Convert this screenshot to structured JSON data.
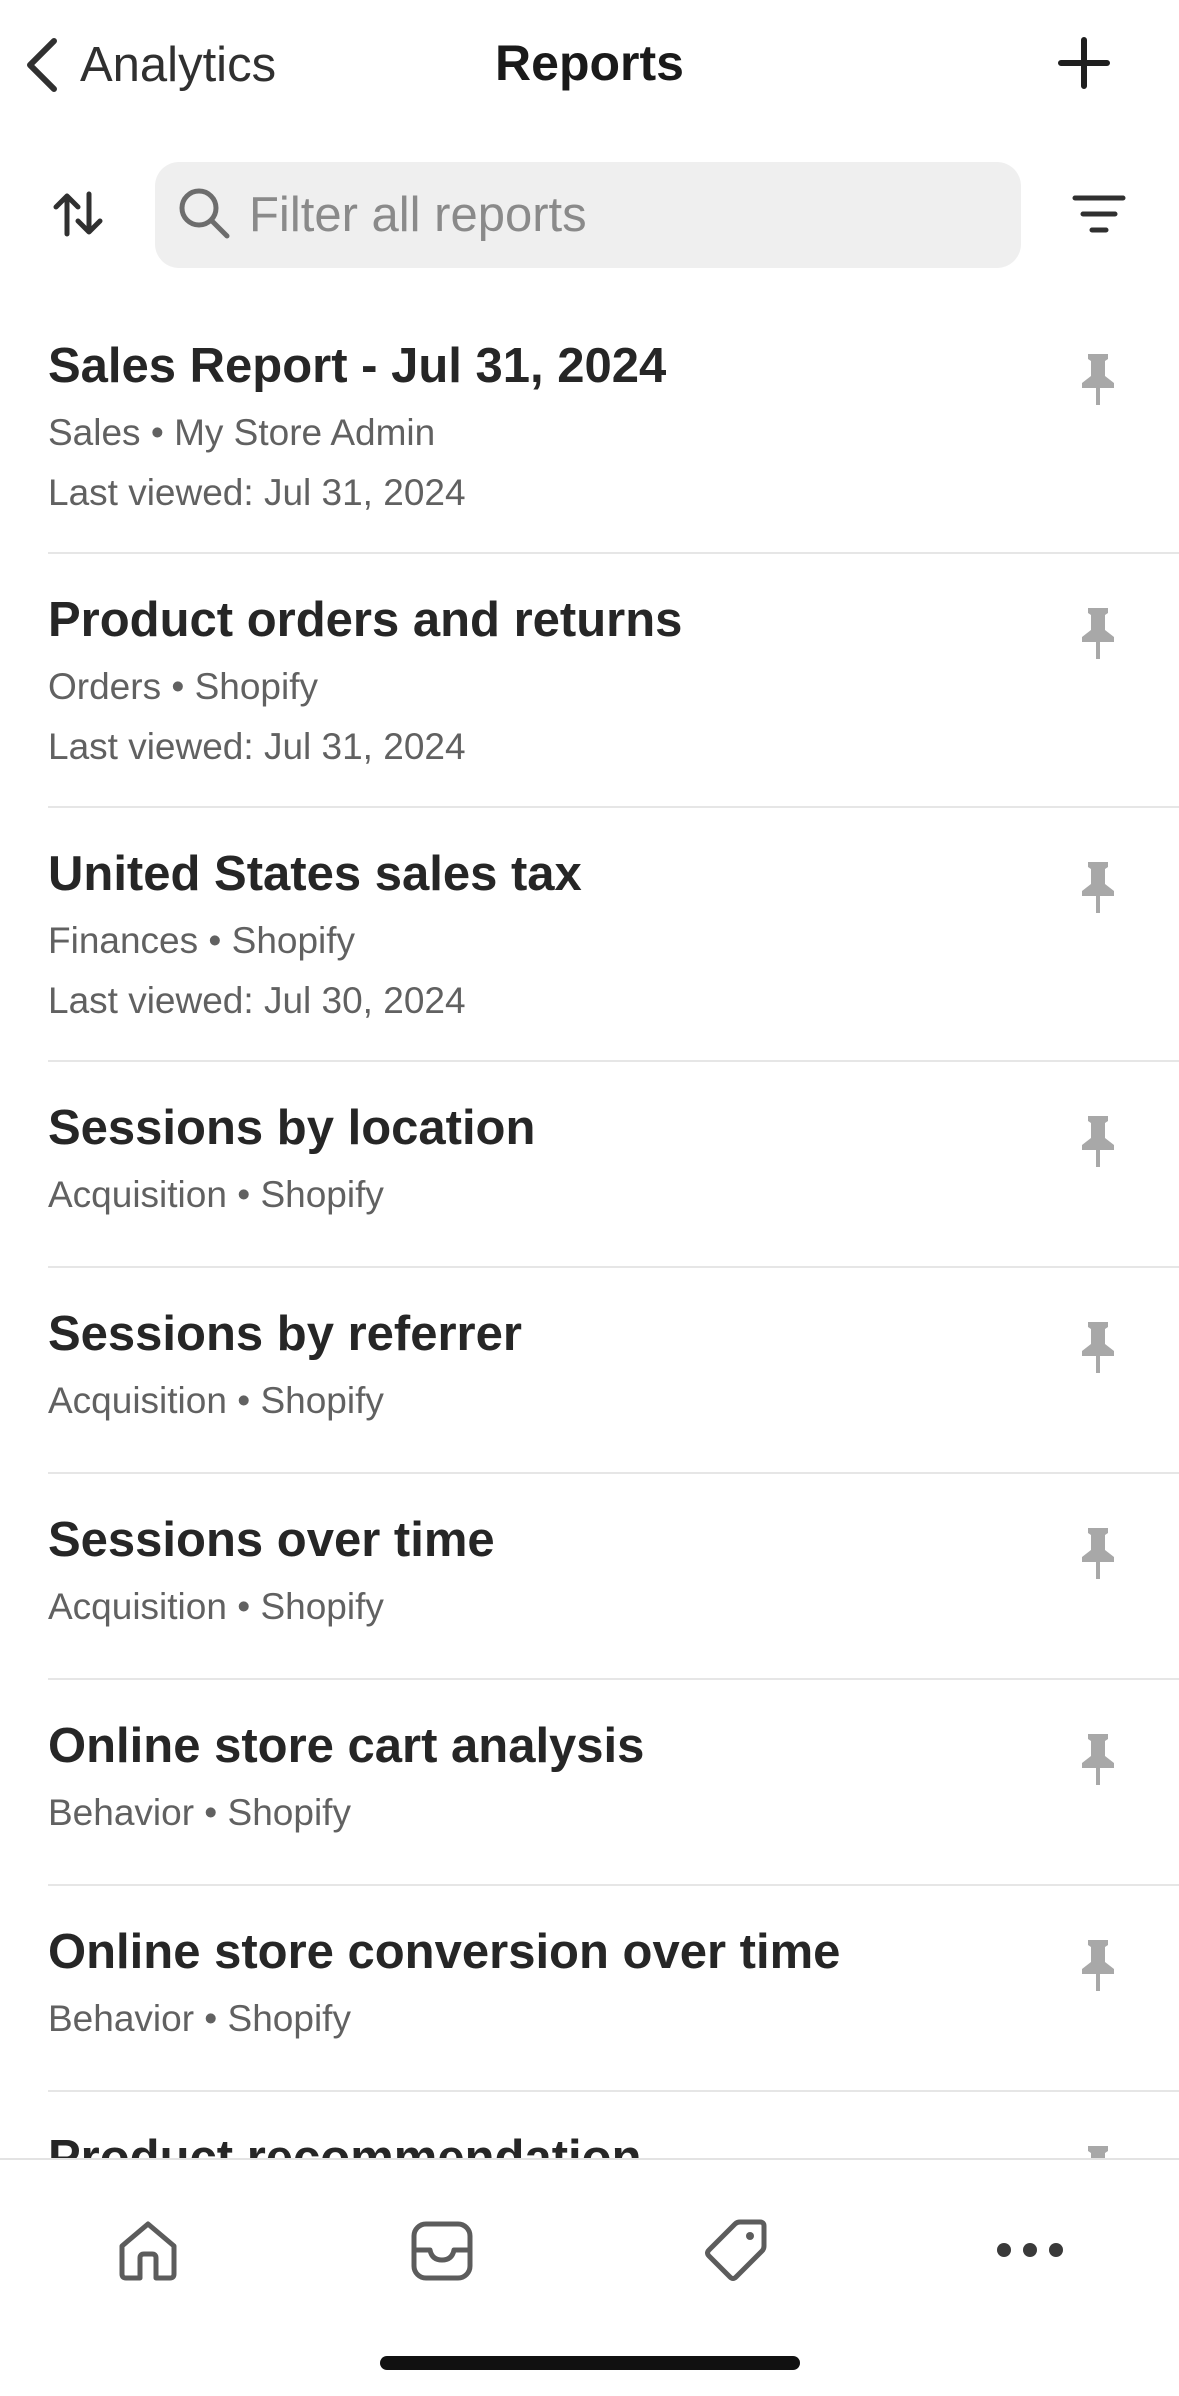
{
  "nav": {
    "back_label": "Analytics",
    "title": "Reports",
    "back_icon": "chevron-left-icon",
    "add_icon": "plus-icon"
  },
  "search": {
    "placeholder": "Filter all reports",
    "value": "",
    "sort_icon": "sort-arrows-icon",
    "filter_icon": "filter-lines-icon"
  },
  "reports": [
    {
      "title": "Sales Report - Jul 31, 2024",
      "meta": "Sales • My Store Admin",
      "viewed": "Last viewed: Jul 31, 2024"
    },
    {
      "title": "Product orders and returns",
      "meta": "Orders • Shopify",
      "viewed": "Last viewed: Jul 31, 2024"
    },
    {
      "title": "United States sales tax",
      "meta": "Finances • Shopify",
      "viewed": "Last viewed: Jul 30, 2024"
    },
    {
      "title": "Sessions by location",
      "meta": "Acquisition • Shopify"
    },
    {
      "title": "Sessions by referrer",
      "meta": "Acquisition • Shopify"
    },
    {
      "title": "Sessions over time",
      "meta": "Acquisition • Shopify"
    },
    {
      "title": "Online store cart analysis",
      "meta": "Behavior • Shopify"
    },
    {
      "title": "Online store conversion over time",
      "meta": "Behavior • Shopify"
    },
    {
      "title": "Product recommendation",
      "meta": ""
    }
  ],
  "tabs": [
    {
      "icon": "home-icon"
    },
    {
      "icon": "inbox-tray-icon"
    },
    {
      "icon": "tag-icon"
    },
    {
      "icon": "more-dots-icon"
    }
  ],
  "colors": {
    "text_primary": "#262626",
    "text_secondary": "#616161",
    "pin_gray": "#a8a8a8",
    "search_bg": "#efefef",
    "divider": "#e6e6e6"
  }
}
